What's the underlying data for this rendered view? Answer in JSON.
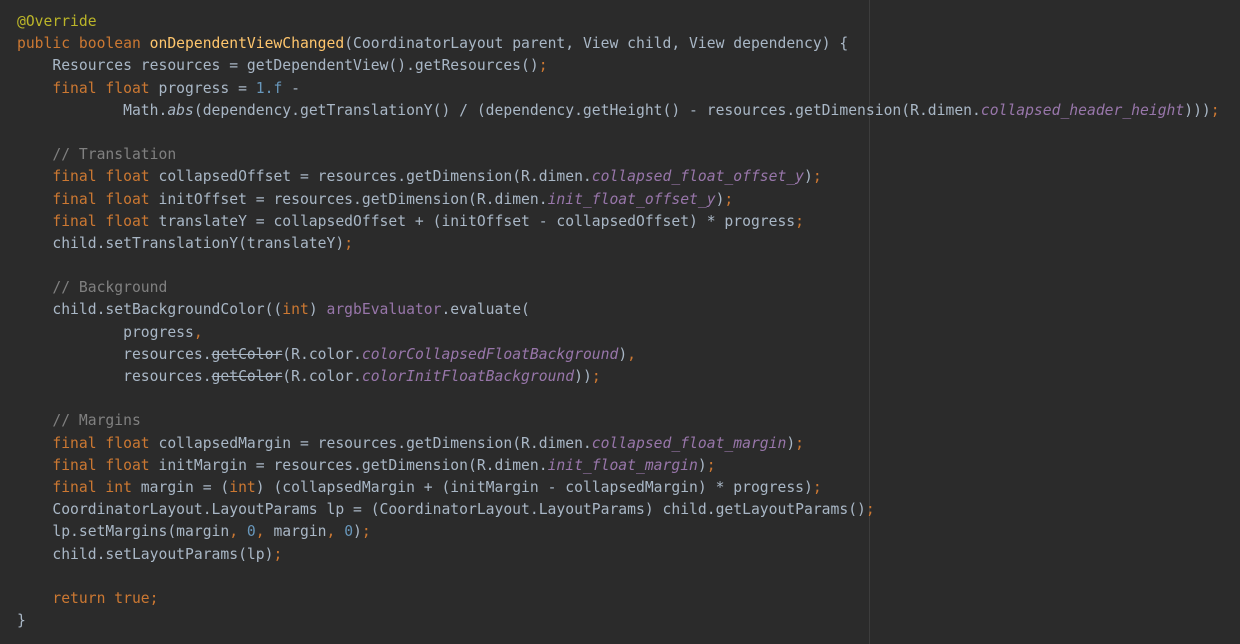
{
  "editor": {
    "theme_colors": {
      "background": "#2b2b2b",
      "text": "#a9b7c6",
      "keyword": "#cc7832",
      "annotation": "#bbb529",
      "method_declaration": "#ffc66d",
      "number": "#6897bb",
      "comment": "#808080",
      "field": "#9876aa",
      "margin_guide": "#3d3d3d"
    },
    "lines": [
      [
        {
          "t": "@Override",
          "c": "ann"
        }
      ],
      [
        {
          "t": "public boolean ",
          "c": "kw"
        },
        {
          "t": "onDependentViewChanged",
          "c": "fn"
        },
        {
          "t": "(CoordinatorLayout parent, View child, View dependency) {",
          "c": "plain"
        }
      ],
      [
        {
          "t": "    Resources resources = getDependentView().getResources()",
          "c": "plain"
        },
        {
          "t": ";",
          "c": "kw"
        }
      ],
      [
        {
          "t": "    final float ",
          "c": "kw"
        },
        {
          "t": "progress = ",
          "c": "plain"
        },
        {
          "t": "1.f ",
          "c": "num"
        },
        {
          "t": "-",
          "c": "plain"
        }
      ],
      [
        {
          "t": "            Math.",
          "c": "plain"
        },
        {
          "t": "abs",
          "c": "staticm"
        },
        {
          "t": "(dependency.getTranslationY() / (dependency.getHeight() - resources.getDimension(R.dimen.",
          "c": "plain"
        },
        {
          "t": "collapsed_header_height",
          "c": "static"
        },
        {
          "t": ")))",
          "c": "plain"
        },
        {
          "t": ";",
          "c": "kw"
        }
      ],
      [],
      [
        {
          "t": "    // Translation",
          "c": "com"
        }
      ],
      [
        {
          "t": "    final float ",
          "c": "kw"
        },
        {
          "t": "collapsedOffset = resources.getDimension(R.dimen.",
          "c": "plain"
        },
        {
          "t": "collapsed_float_offset_y",
          "c": "static"
        },
        {
          "t": ")",
          "c": "plain"
        },
        {
          "t": ";",
          "c": "kw"
        }
      ],
      [
        {
          "t": "    final float ",
          "c": "kw"
        },
        {
          "t": "initOffset = resources.getDimension(R.dimen.",
          "c": "plain"
        },
        {
          "t": "init_float_offset_y",
          "c": "static"
        },
        {
          "t": ")",
          "c": "plain"
        },
        {
          "t": ";",
          "c": "kw"
        }
      ],
      [
        {
          "t": "    final float ",
          "c": "kw"
        },
        {
          "t": "translateY = collapsedOffset + (initOffset - collapsedOffset) * progress",
          "c": "plain"
        },
        {
          "t": ";",
          "c": "kw"
        }
      ],
      [
        {
          "t": "    child.setTranslationY(translateY)",
          "c": "plain"
        },
        {
          "t": ";",
          "c": "kw"
        }
      ],
      [],
      [
        {
          "t": "    // Background",
          "c": "com"
        }
      ],
      [
        {
          "t": "    child.setBackgroundColor((",
          "c": "plain"
        },
        {
          "t": "int",
          "c": "kw"
        },
        {
          "t": ") ",
          "c": "plain"
        },
        {
          "t": "argbEvaluator",
          "c": "field"
        },
        {
          "t": ".evaluate(",
          "c": "plain"
        }
      ],
      [
        {
          "t": "            progress",
          "c": "plain"
        },
        {
          "t": ",",
          "c": "kw"
        }
      ],
      [
        {
          "t": "            resources.",
          "c": "plain"
        },
        {
          "t": "getColor",
          "c": "dep"
        },
        {
          "t": "(R.color.",
          "c": "plain"
        },
        {
          "t": "colorCollapsedFloatBackground",
          "c": "static"
        },
        {
          "t": ")",
          "c": "plain"
        },
        {
          "t": ",",
          "c": "kw"
        }
      ],
      [
        {
          "t": "            resources.",
          "c": "plain"
        },
        {
          "t": "getColor",
          "c": "dep"
        },
        {
          "t": "(R.color.",
          "c": "plain"
        },
        {
          "t": "colorInitFloatBackground",
          "c": "static"
        },
        {
          "t": "))",
          "c": "plain"
        },
        {
          "t": ";",
          "c": "kw"
        }
      ],
      [],
      [
        {
          "t": "    // Margins",
          "c": "com"
        }
      ],
      [
        {
          "t": "    final float ",
          "c": "kw"
        },
        {
          "t": "collapsedMargin = resources.getDimension(R.dimen.",
          "c": "plain"
        },
        {
          "t": "collapsed_float_margin",
          "c": "static"
        },
        {
          "t": ")",
          "c": "plain"
        },
        {
          "t": ";",
          "c": "kw"
        }
      ],
      [
        {
          "t": "    final float ",
          "c": "kw"
        },
        {
          "t": "initMargin = resources.getDimension(R.dimen.",
          "c": "plain"
        },
        {
          "t": "init_float_margin",
          "c": "static"
        },
        {
          "t": ")",
          "c": "plain"
        },
        {
          "t": ";",
          "c": "kw"
        }
      ],
      [
        {
          "t": "    final int ",
          "c": "kw"
        },
        {
          "t": "margin = (",
          "c": "plain"
        },
        {
          "t": "int",
          "c": "kw"
        },
        {
          "t": ") (collapsedMargin + (initMargin - collapsedMargin) * progress)",
          "c": "plain"
        },
        {
          "t": ";",
          "c": "kw"
        }
      ],
      [
        {
          "t": "    CoordinatorLayout.LayoutParams lp = (CoordinatorLayout.LayoutParams) child.getLayoutParams()",
          "c": "plain"
        },
        {
          "t": ";",
          "c": "kw"
        }
      ],
      [
        {
          "t": "    lp.setMargins(margin",
          "c": "plain"
        },
        {
          "t": ", ",
          "c": "kw"
        },
        {
          "t": "0",
          "c": "num"
        },
        {
          "t": ", ",
          "c": "kw"
        },
        {
          "t": "margin",
          "c": "plain"
        },
        {
          "t": ", ",
          "c": "kw"
        },
        {
          "t": "0",
          "c": "num"
        },
        {
          "t": ")",
          "c": "plain"
        },
        {
          "t": ";",
          "c": "kw"
        }
      ],
      [
        {
          "t": "    child.setLayoutParams(lp)",
          "c": "plain"
        },
        {
          "t": ";",
          "c": "kw"
        }
      ],
      [],
      [
        {
          "t": "    return true",
          "c": "kw"
        },
        {
          "t": ";",
          "c": "kw"
        }
      ],
      [
        {
          "t": "}",
          "c": "plain"
        }
      ]
    ]
  }
}
